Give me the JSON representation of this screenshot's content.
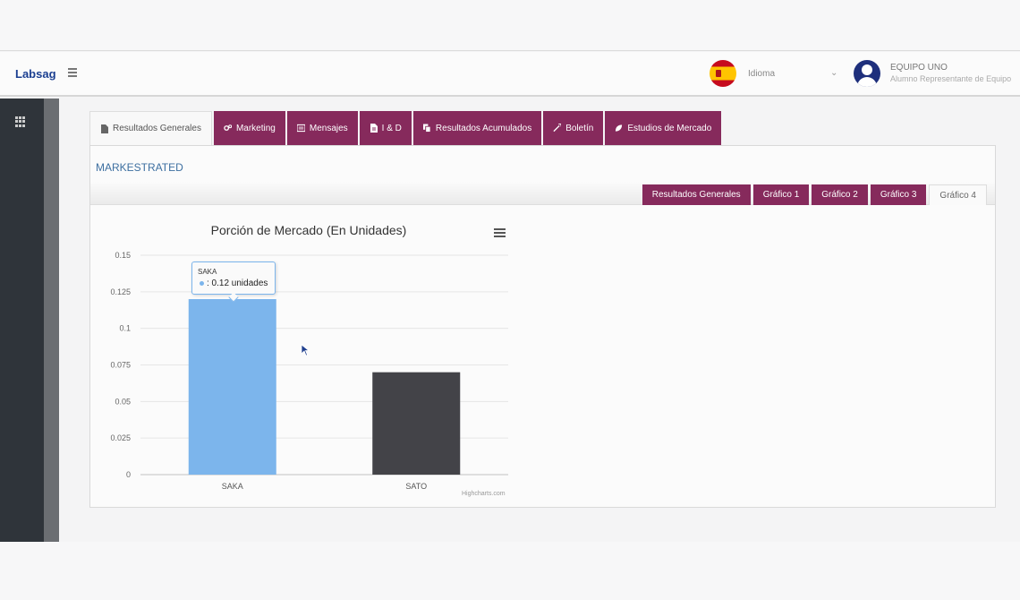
{
  "app": {
    "brand": "Labsag"
  },
  "header": {
    "language_label": "Idioma",
    "language_chevron": "⌄",
    "user_name": "EQUIPO UNO",
    "user_role": "Alumno Representante de Equipo"
  },
  "tabs": [
    {
      "label": "Resultados Generales",
      "icon": "file-icon",
      "active": true
    },
    {
      "label": "Marketing",
      "icon": "gears-icon",
      "active": false
    },
    {
      "label": "Mensajes",
      "icon": "list-icon",
      "active": false
    },
    {
      "label": "I & D",
      "icon": "document-icon",
      "active": false
    },
    {
      "label": "Resultados Acumulados",
      "icon": "copy-icon",
      "active": false
    },
    {
      "label": "Boletín",
      "icon": "magic-icon",
      "active": false
    },
    {
      "label": "Estudios de Mercado",
      "icon": "leaf-icon",
      "active": false
    }
  ],
  "section": {
    "title": "MARKESTRATED"
  },
  "subtabs": [
    {
      "label": "Resultados Generales",
      "active": false
    },
    {
      "label": "Gráfico 1",
      "active": false
    },
    {
      "label": "Gráfico 2",
      "active": false
    },
    {
      "label": "Gráfico 3",
      "active": false
    },
    {
      "label": "Gráfico 4",
      "active": true
    }
  ],
  "colors": {
    "accent": "#862a5c",
    "series_highlight": "#7cb5ec",
    "series_default": "#434348"
  },
  "tooltip": {
    "category": "SAKA",
    "value_text": ": 0.12 unidades"
  },
  "chart_data": {
    "type": "bar",
    "title": "Porción de Mercado (En Unidades)",
    "categories": [
      "SAKA",
      "SATO"
    ],
    "values": [
      0.12,
      0.07
    ],
    "ylim": [
      0,
      0.15
    ],
    "yticks": [
      "0",
      "0.025",
      "0.05",
      "0.075",
      "0.1",
      "0.125",
      "0.15"
    ],
    "ytick_values": [
      0,
      0.025,
      0.05,
      0.075,
      0.1,
      0.125,
      0.15
    ],
    "grid": true,
    "legend": "none",
    "credits": "Highcharts.com"
  }
}
